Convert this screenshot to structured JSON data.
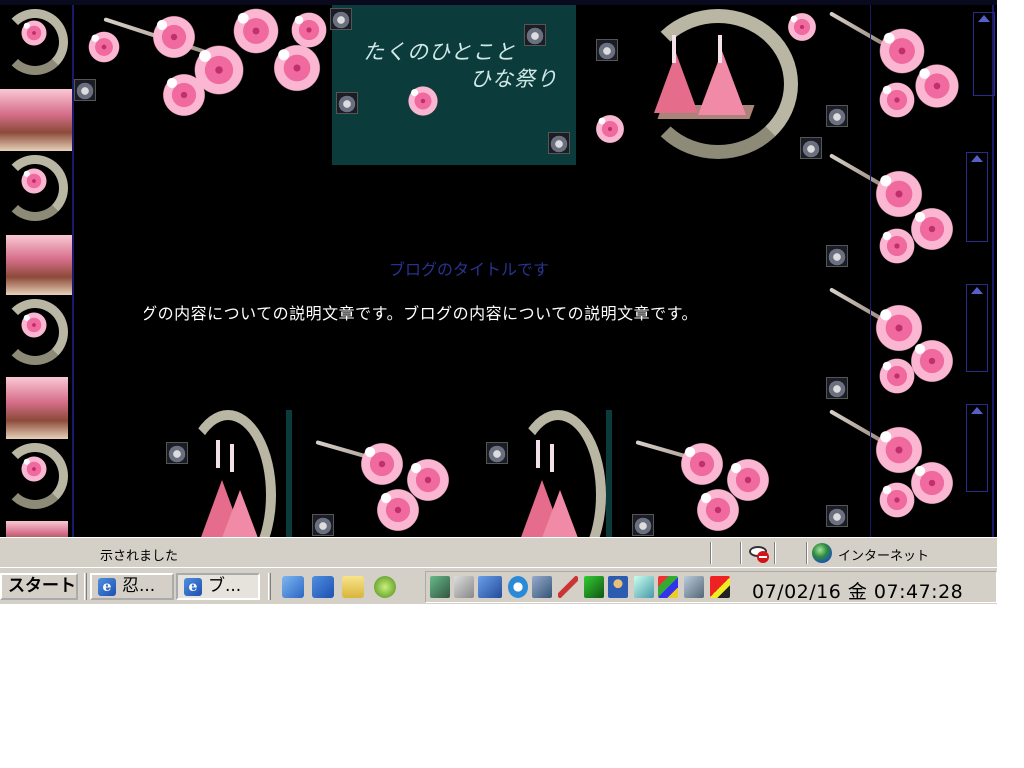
{
  "page": {
    "header_line1": "たくのひとこと",
    "header_line2": "ひな祭り",
    "blog_title": "ブログのタイトルです",
    "blog_description": "ブログの内容についての説明文章です。ブログの内容についての説明文章です。"
  },
  "statusbar": {
    "status_text": "示されました",
    "zone_label": "インターネット",
    "zone_icon": "globe-icon",
    "privacy_icon": "privacy-blocked-icon"
  },
  "taskbar": {
    "start_label": "スタート",
    "tasks": [
      {
        "label": "忍...",
        "icon": "ie-icon",
        "active": false
      },
      {
        "label": "ブ...",
        "icon": "ie-icon",
        "active": true
      }
    ],
    "quicklaunch": [
      "refresh-icon",
      "ie-icon",
      "folder-icon",
      "media-icon"
    ],
    "tray_icons": [
      "network-icon",
      "volume-icon",
      "year30-icon",
      "clock-app-icon",
      "monitor-icon",
      "pen-icon",
      "update-icon",
      "users-icon",
      "display-icon",
      "windows-icon",
      "download-icon",
      "shield-icon"
    ],
    "clock": "07/02/16 金 07:47:28"
  },
  "colors": {
    "teal_panel": "#0c3b3c",
    "blossom_pink": "#f06aa0",
    "title_blue": "#29338f"
  }
}
